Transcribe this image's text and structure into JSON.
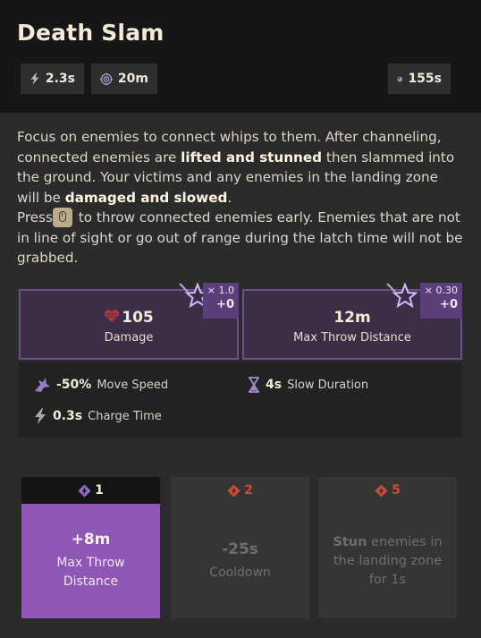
{
  "ability": {
    "title": "Death Slam",
    "stats": {
      "charge_time": "2.3s",
      "range": "20m",
      "cooldown": "155s"
    }
  },
  "description": {
    "p1_a": "Focus on enemies to connect whips to them. After channeling, connected enemies are ",
    "p1_b": "lifted and stunned",
    "p1_c": " then slammed into the ground. Your victims and any enemies in the landing zone will be ",
    "p1_d": "damaged and slowed",
    "p1_e": ".",
    "p2_a": "Press",
    "p2_b": " to throw connected enemies early. Enemies that are not in line of sight or go out of range during the latch time will not be grabbed."
  },
  "stat_cards": [
    {
      "value": "105",
      "label": "Damage",
      "scale": "× 1.0",
      "bonus": "+0",
      "icon": "heart-icon"
    },
    {
      "value": "12m",
      "label": "Max Throw Distance",
      "scale": "× 0.30",
      "bonus": "+0",
      "icon": "none"
    }
  ],
  "bonuses": [
    {
      "value": "-50%",
      "label": "Move Speed",
      "icon": "slow-boot-icon"
    },
    {
      "value": "4s",
      "label": "Slow Duration",
      "icon": "hourglass-icon"
    },
    {
      "value": "0.3s",
      "label": "Charge Time",
      "icon": "lightning-icon"
    }
  ],
  "upgrades": [
    {
      "cost": "1",
      "value": "+8m",
      "label": "Max Throw Distance",
      "state": "active"
    },
    {
      "cost": "2",
      "value": "-25s",
      "label": "Cooldown",
      "state": "locked"
    },
    {
      "cost": "5",
      "value_bold": "Stun",
      "label": " enemies in the landing zone for 1s",
      "state": "locked"
    }
  ],
  "colors": {
    "accent_purple": "#8e57b6",
    "card_border": "#6a5283",
    "locked_red": "#d24a33"
  }
}
